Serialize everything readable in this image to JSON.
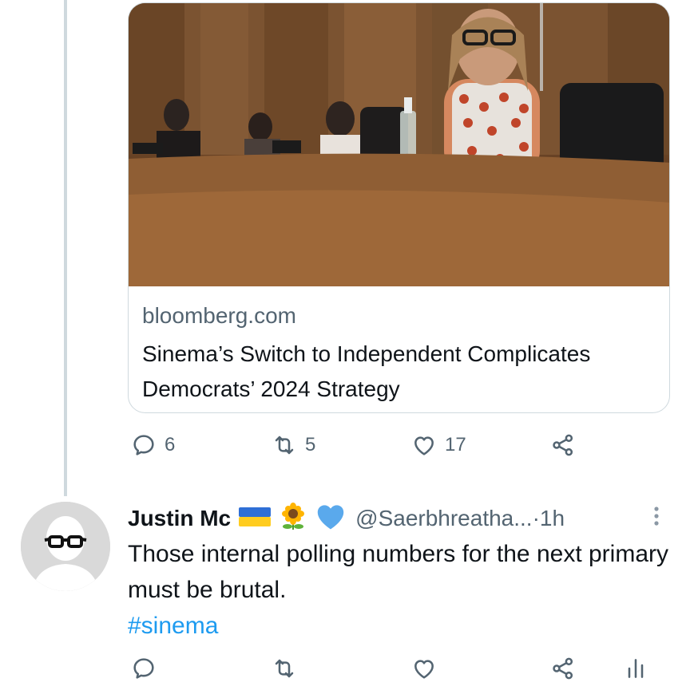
{
  "link_card": {
    "domain": "bloomberg.com",
    "title": "Sinema’s Switch to Independent Complicates Democrats’ 2024 Strategy"
  },
  "tweet_actions": {
    "replies": "6",
    "retweets": "5",
    "likes": "17"
  },
  "reply": {
    "display_name": "Justin Mc",
    "handle": "@Saerbhreatha...",
    "separator": " · ",
    "time": "1h",
    "text": "Those internal polling numbers for the next primary must be brutal.",
    "hashtag": "#sinema",
    "emojis": [
      "flag-ukraine-icon",
      "sunflower-icon",
      "blue-heart-icon"
    ]
  },
  "colors": {
    "text_primary": "#0f1419",
    "text_secondary": "#536471",
    "link_blue": "#1d9bf0",
    "border": "#cfd9de",
    "heart_blue": "#5aa9ec"
  }
}
